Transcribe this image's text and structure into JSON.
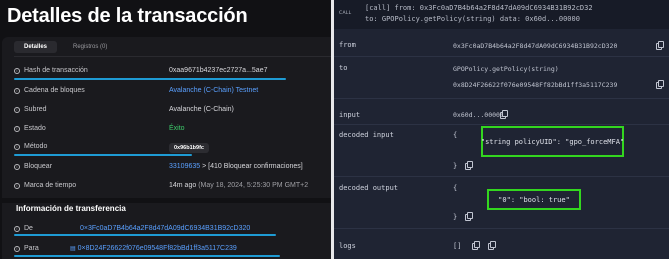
{
  "left": {
    "title": "Detalles de la transacción",
    "tabs": [
      {
        "label": "Detalles"
      },
      {
        "label": "Registros (0)"
      }
    ],
    "rows": {
      "hash": {
        "label": "Hash de transacción",
        "value": "0xaa9671b4237ec2727a...5ae7"
      },
      "chain": {
        "label": "Cadena de bloques",
        "value": "Avalanche (C-Chain) Testnet"
      },
      "subnet": {
        "label": "Subred",
        "value": "Avalanche (C-Chain)"
      },
      "status": {
        "label": "Estado",
        "value": "Éxito"
      },
      "method": {
        "label": "Método",
        "value": "0x96b1b9fc"
      },
      "block": {
        "label": "Bloquear",
        "value": "33109635",
        "extra": "> [410 Bloquear confirmaciones]"
      },
      "timestamp": {
        "label": "Marca de tiempo",
        "value": "14m ago",
        "extra": "(May 18, 2024, 5:25:30 PM GMT+2"
      }
    },
    "transfer": {
      "title": "Información de transferencia",
      "from": {
        "label": "De",
        "value": "0×3Fc0aD7B4b64a2F8d47dA09dC6934B31B92cD320"
      },
      "to": {
        "label": "Para",
        "value": "0×8D24F26622f076e09548Ff82bBd1ff3a5117C239"
      }
    }
  },
  "right": {
    "call_tag": "CALL",
    "call_line1": "[call]  from: 0x3Fc0aD7B4b64a2F8d47dA09dC6934B31B92cD32",
    "call_line2": "to: GPOPolicy.getPolicy(string) data: 0x60d...00000",
    "from": {
      "label": "from",
      "value": "0x3Fc0aD7B4b64a2F8d47dA09dC6934B31B92cD320"
    },
    "to": {
      "label": "to",
      "value1": "GPOPolicy.getPolicy(string)",
      "value2": "0x8D24F26622f076e09548Ff82bBd1ff3a5117C239"
    },
    "input": {
      "label": "input",
      "value": "0x60d...00000"
    },
    "decoded_input": {
      "label": "decoded input",
      "open": "{",
      "close": "}",
      "entry": "\"string policyUID\": \"gpo_forceMFA\""
    },
    "decoded_output": {
      "label": "decoded output",
      "open": "{",
      "close": "}",
      "entry": "\"0\": \"bool: true\""
    },
    "logs": {
      "label": "logs",
      "value": "[]"
    }
  },
  "colors": {
    "accent_underline": "#1e9bd4",
    "highlight_box": "#33d61f",
    "link": "#5aa0ff",
    "success": "#3dcc6b"
  }
}
